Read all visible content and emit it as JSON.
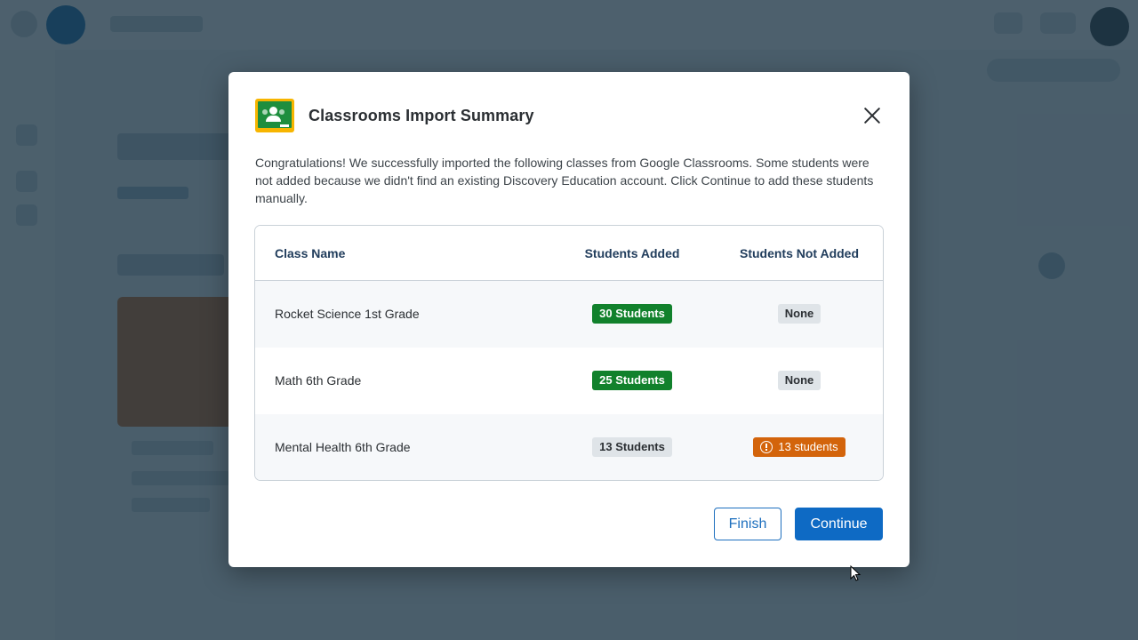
{
  "modal": {
    "title": "Classrooms Import Summary",
    "logo_icon": "google-classroom-icon",
    "close_icon": "close-icon",
    "intro": "Congratulations! We successfully imported the following classes from Google Classrooms. Some students were not added because we didn't find an existing Discovery Education account. Click Continue to add these students manually.",
    "table": {
      "headers": {
        "class_name": "Class Name",
        "students_added": "Students Added",
        "students_not_added": "Students Not Added"
      },
      "rows": [
        {
          "class_name": "Rocket Science 1st Grade",
          "added": "30 Students",
          "added_status": "success",
          "not_added": "None",
          "not_added_status": "none"
        },
        {
          "class_name": "Math 6th Grade",
          "added": "25 Students",
          "added_status": "success",
          "not_added": "None",
          "not_added_status": "none"
        },
        {
          "class_name": "Mental Health 6th Grade",
          "added": "13 Students",
          "added_status": "neutral",
          "not_added": "13 students",
          "not_added_status": "warning"
        }
      ]
    },
    "buttons": {
      "finish": "Finish",
      "continue": "Continue"
    }
  },
  "colors": {
    "success_badge": "#11812c",
    "warning_badge": "#d3640b",
    "neutral_badge": "#dfe4e8",
    "primary_button": "#0e6ac4",
    "header_text": "#213d5c"
  }
}
